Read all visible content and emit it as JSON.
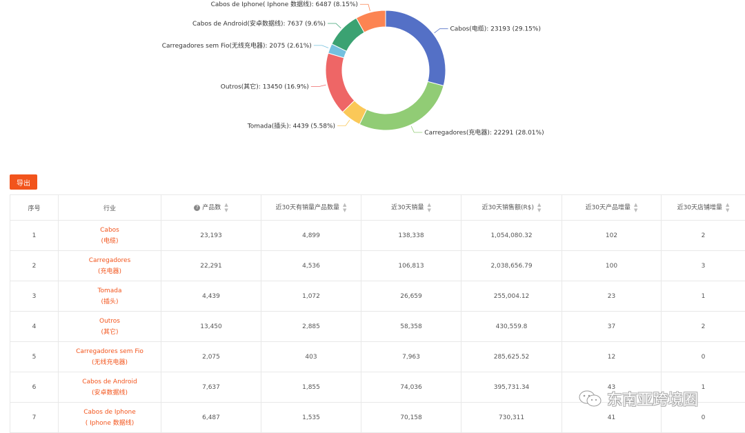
{
  "chart_data": {
    "type": "pie",
    "style": "donut",
    "slices": [
      {
        "label": "Cabos(电缆)",
        "value": 23193,
        "percent": 29.15,
        "color": "#5470c6"
      },
      {
        "label": "Carregadores(充电器)",
        "value": 22291,
        "percent": 28.01,
        "color": "#91cc75"
      },
      {
        "label": "Tomada(插头)",
        "value": 4439,
        "percent": 5.58,
        "color": "#fac858"
      },
      {
        "label": "Outros(其它)",
        "value": 13450,
        "percent": 16.9,
        "color": "#ee6666"
      },
      {
        "label": "Carregadores sem Fio(无线充电器)",
        "value": 2075,
        "percent": 2.61,
        "color": "#73c0de"
      },
      {
        "label": "Cabos de Android(安卓数据线)",
        "value": 7637,
        "percent": 9.6,
        "color": "#3ba272"
      },
      {
        "label": "Cabos de Iphone( Iphone 数据线)",
        "value": 6487,
        "percent": 8.15,
        "color": "#fc8452"
      }
    ],
    "labels": [
      "Cabos(电缆): 23193 (29.15%)",
      "Carregadores(充电器): 22291 (28.01%)",
      "Tomada(插头): 4439 (5.58%)",
      "Outros(其它): 13450 (16.9%)",
      "Carregadores sem Fio(无线充电器): 2075 (2.61%)",
      "Cabos de Android(安卓数据线): 7637 (9.6%)",
      "Cabos de Iphone( Iphone 数据线): 6487 (8.15%)"
    ]
  },
  "toolbar": {
    "export_label": "导出"
  },
  "table": {
    "headers": [
      "序号",
      "行业",
      "产品数",
      "近30天有销量产品数量",
      "近30天销量",
      "近30天销售额(R$)",
      "近30天产品增量",
      "近30天店铺增量"
    ],
    "rows": [
      {
        "no": "1",
        "name": "Cabos",
        "sub": "(电缆)",
        "products": "23,193",
        "sold_products": "4,899",
        "sales": "138,338",
        "revenue": "1,054,080.32",
        "product_inc": "102",
        "store_inc": "2"
      },
      {
        "no": "2",
        "name": "Carregadores",
        "sub": "(充电器)",
        "products": "22,291",
        "sold_products": "4,536",
        "sales": "106,813",
        "revenue": "2,038,656.79",
        "product_inc": "100",
        "store_inc": "3"
      },
      {
        "no": "3",
        "name": "Tomada",
        "sub": "(插头)",
        "products": "4,439",
        "sold_products": "1,072",
        "sales": "26,659",
        "revenue": "255,004.12",
        "product_inc": "23",
        "store_inc": "1"
      },
      {
        "no": "4",
        "name": "Outros",
        "sub": "(其它)",
        "products": "13,450",
        "sold_products": "2,885",
        "sales": "58,358",
        "revenue": "430,559.8",
        "product_inc": "37",
        "store_inc": "2"
      },
      {
        "no": "5",
        "name": "Carregadores sem Fio",
        "sub": "(无线充电器)",
        "products": "2,075",
        "sold_products": "403",
        "sales": "7,963",
        "revenue": "285,625.52",
        "product_inc": "12",
        "store_inc": "0"
      },
      {
        "no": "6",
        "name": "Cabos de Android",
        "sub": "(安卓数据线)",
        "products": "7,637",
        "sold_products": "1,855",
        "sales": "74,036",
        "revenue": "395,731.34",
        "product_inc": "43",
        "store_inc": "1"
      },
      {
        "no": "7",
        "name": "Cabos de Iphone",
        "sub": "( Iphone 数据线)",
        "products": "6,487",
        "sold_products": "1,535",
        "sales": "70,158",
        "revenue": "730,311",
        "product_inc": "41",
        "store_inc": "0"
      }
    ]
  },
  "icons": {
    "help": "question-circle-icon",
    "sort": "sort-icon",
    "wechat": "wechat-icon"
  },
  "watermark": {
    "text": "东南亚跨境圈"
  }
}
